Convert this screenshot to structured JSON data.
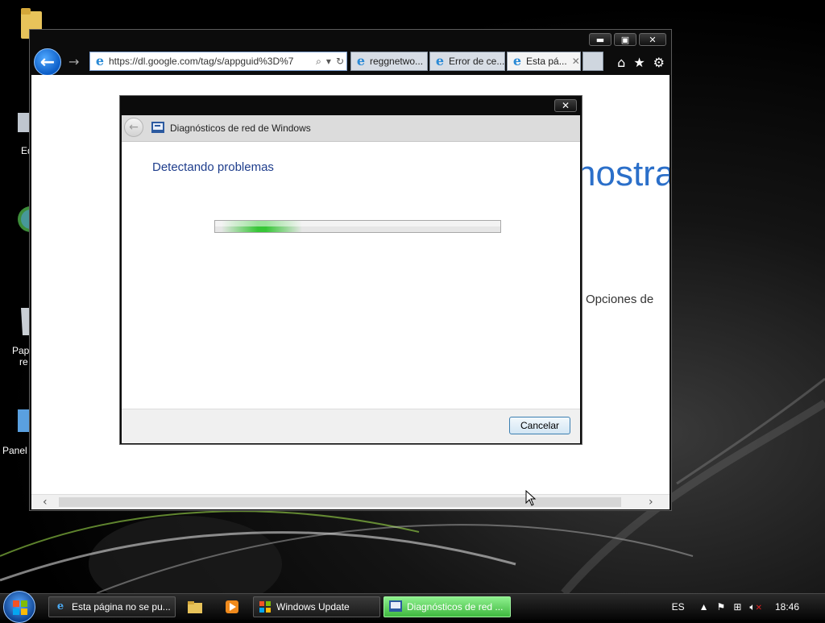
{
  "browser": {
    "address": {
      "url": "https://dl.google.com/tag/s/appguid%3D%7"
    },
    "tabs": [
      {
        "label": "reggnetwo...",
        "active": false
      },
      {
        "label": "Error de ce...",
        "active": false
      },
      {
        "label": "Esta pá...",
        "active": true
      }
    ],
    "page": {
      "heading_fragment": "nostra",
      "text_fragment": "Opciones de"
    }
  },
  "dialog": {
    "title": "Diagnósticos de red de Windows",
    "heading": "Detectando problemas",
    "cancel_label": "Cancelar"
  },
  "taskbar": {
    "items": [
      {
        "label": "Esta página no se pu...",
        "icon": "ie-icon"
      },
      {
        "label": "Windows Update",
        "icon": "windows-update-icon"
      },
      {
        "label": "Diagnósticos de red ...",
        "icon": "network-diagnostics-icon",
        "active": true
      }
    ],
    "language": "ES",
    "clock": "18:46"
  },
  "desktop": {
    "icon_labels": [
      "Eq",
      "Pap",
      "re",
      "Panel"
    ]
  },
  "colors": {
    "accent": "#2b6fc9",
    "dialog_heading": "#1e3d8c",
    "progress": "#37c637"
  }
}
